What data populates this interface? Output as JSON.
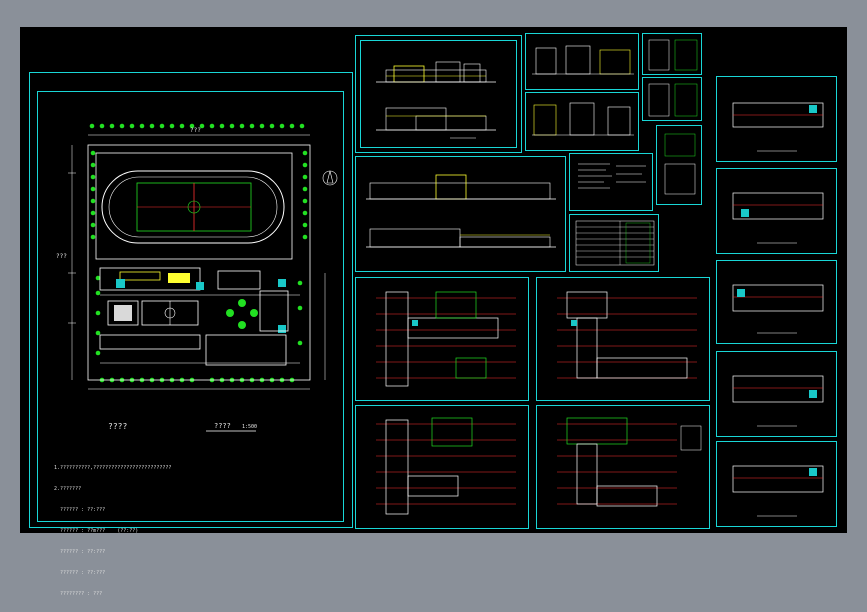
{
  "drawing": {
    "site_title": "????",
    "site_scale_label": "????",
    "site_scale_value": "1:500",
    "site_dim_top": "???",
    "site_dim_left": "???",
    "notes": [
      "1.??????????,??????????????????????????",
      "2.???????",
      "  ?????? : ??:???",
      "  ?????? : ??m???    (??:??)",
      "  ?????? : ??:???",
      "  ?????? : ??:???",
      "  ???????? : ???"
    ]
  },
  "colors": {
    "background": "#8a9099",
    "canvas": "#000000",
    "border": "#19d6d6",
    "tree": "#22e022",
    "wall": "#ff3030",
    "line": "#ffffff",
    "accent": "#ffff30",
    "fill": "#19c8c8"
  }
}
